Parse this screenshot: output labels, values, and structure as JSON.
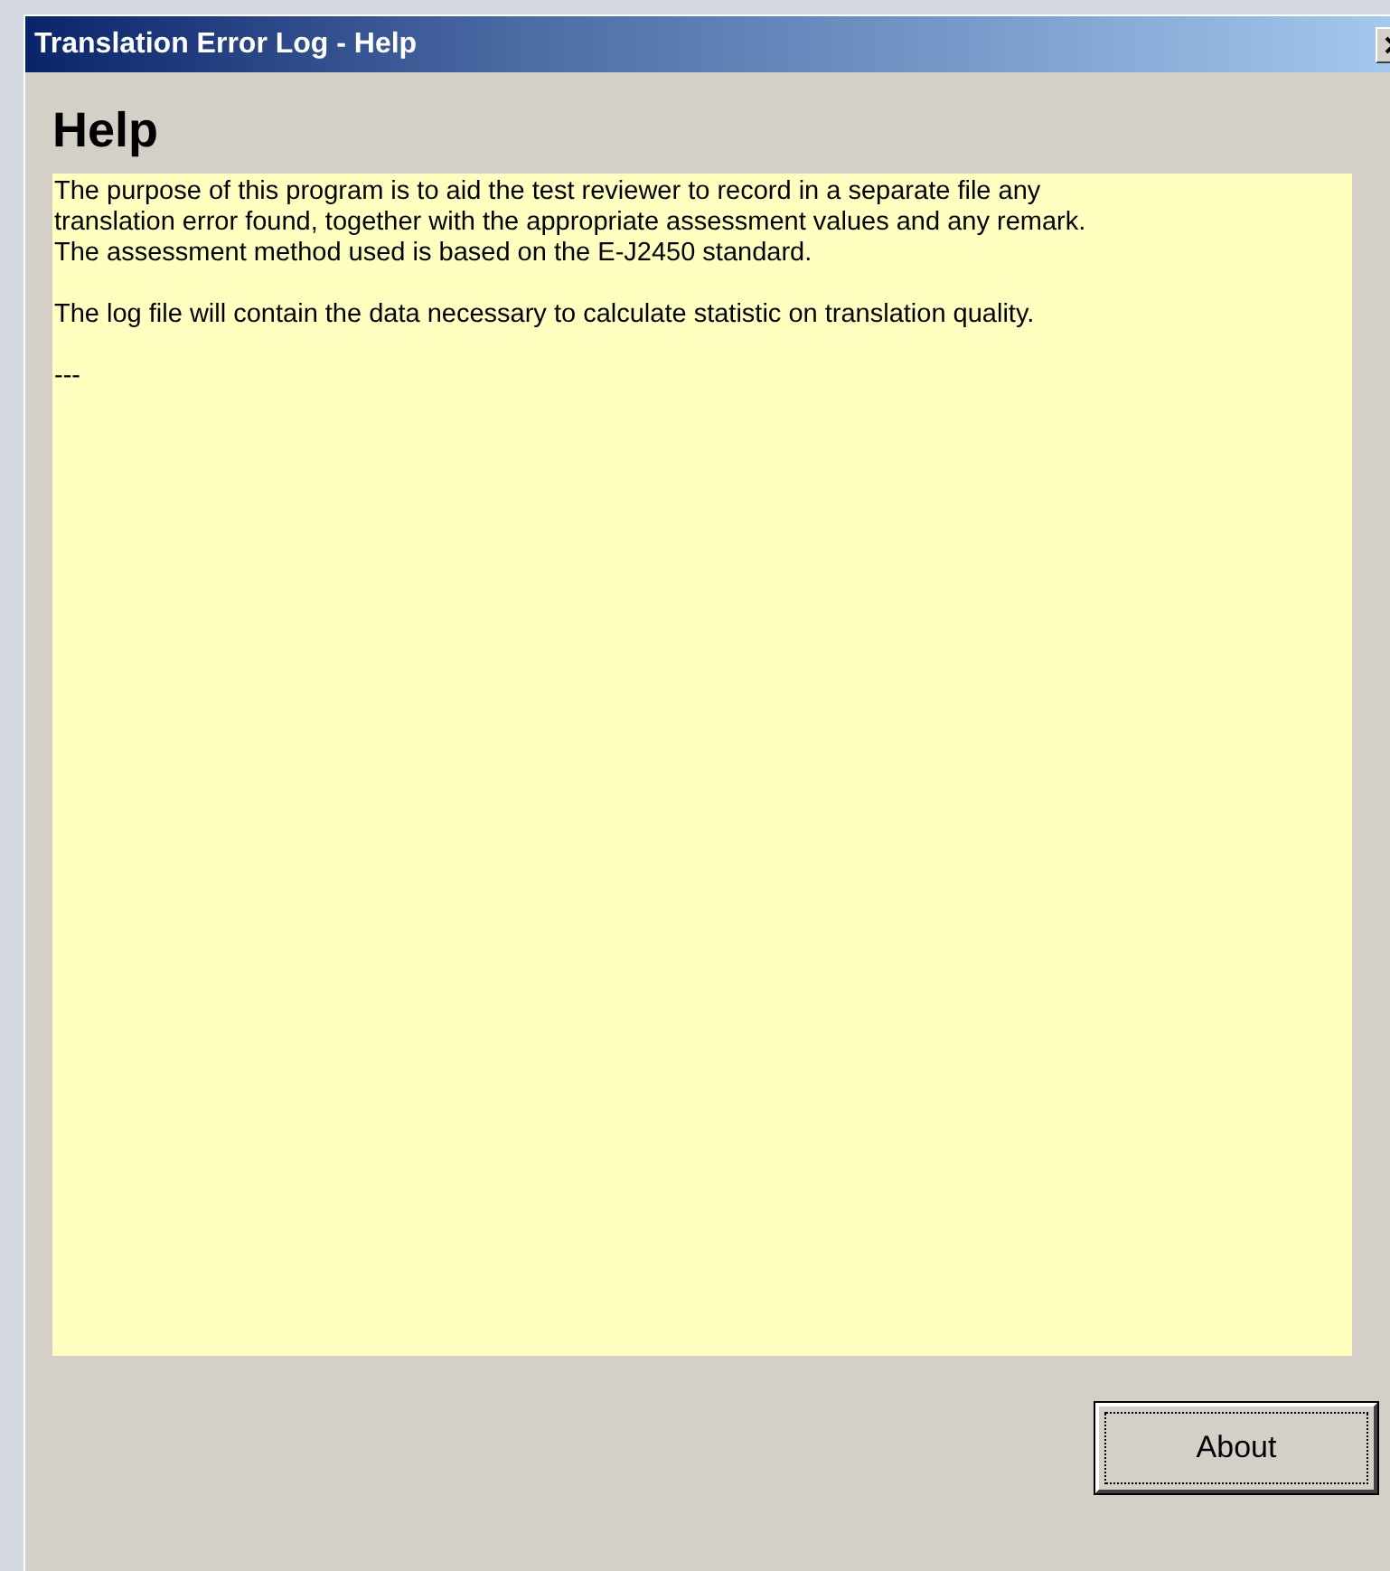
{
  "window": {
    "title": "Translation Error Log - Help"
  },
  "heading": "Help",
  "help_text": [
    "The purpose of this program is to aid the test reviewer to record in a separate file any\ntranslation error found, together with the appropriate assessment values and any remark.\nThe assessment method used is based on the E-J2450 standard.",
    "The log file will contain the data necessary to calculate statistic on translation quality.",
    "---"
  ],
  "buttons": [
    {
      "label": "About",
      "focused": true
    }
  ]
}
